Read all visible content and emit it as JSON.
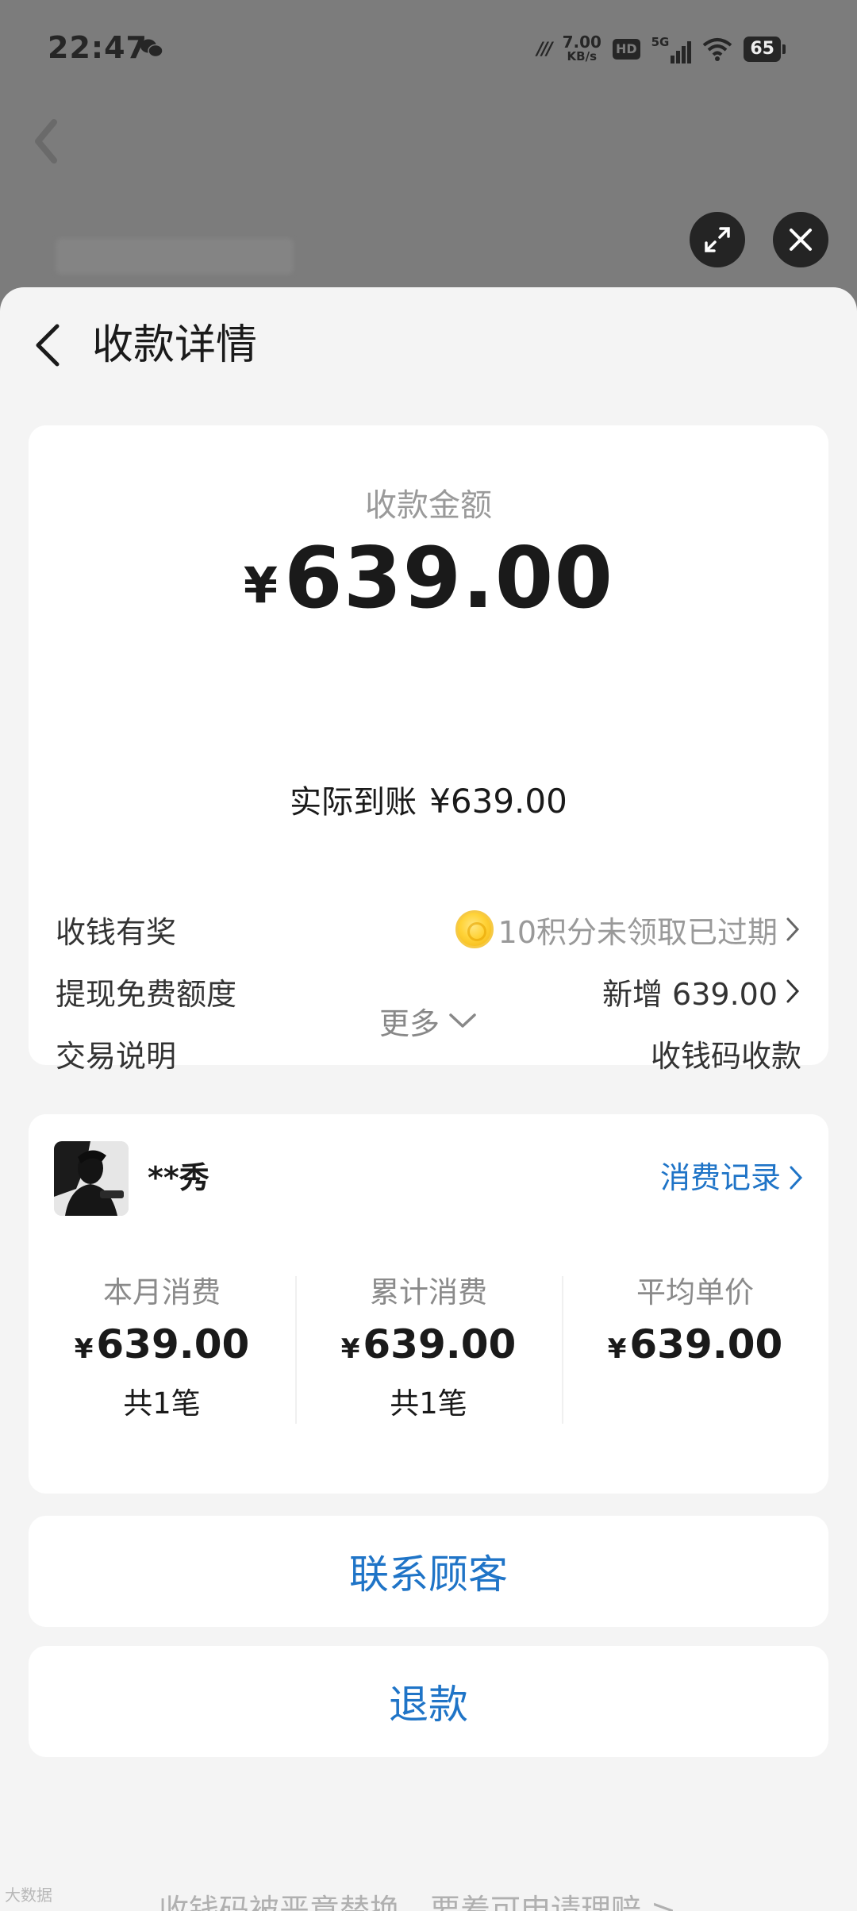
{
  "status_bar": {
    "time": "22:47",
    "speed_value": "7.00",
    "speed_unit": "KB/s",
    "hd": "HD",
    "network": "5G",
    "battery": "65"
  },
  "header": {
    "title": "收款详情"
  },
  "amount_card": {
    "label": "收款金额",
    "currency": "¥",
    "amount": "639.00",
    "actual_label": "实际到账",
    "actual_value": "¥639.00",
    "rows": [
      {
        "label": "收钱有奖",
        "value": "10积分未领取已过期"
      },
      {
        "label": "提现免费额度",
        "value": "新增 639.00"
      },
      {
        "label": "交易说明",
        "value": "收钱码收款"
      }
    ],
    "more_label": "更多"
  },
  "customer_card": {
    "name": "**秀",
    "records_link": "消费记录",
    "stats": [
      {
        "label": "本月消费",
        "currency": "¥",
        "value": "639.00",
        "count": "共1笔"
      },
      {
        "label": "累计消费",
        "currency": "¥",
        "value": "639.00",
        "count": "共1笔"
      },
      {
        "label": "平均单价",
        "currency": "¥",
        "value": "639.00",
        "count": ""
      }
    ]
  },
  "actions": {
    "contact": "联系顾客",
    "refund": "退款"
  },
  "bottom_tip": "收钱码被恶意替换，要着可申请理赔 >",
  "watermark": "大数据"
}
